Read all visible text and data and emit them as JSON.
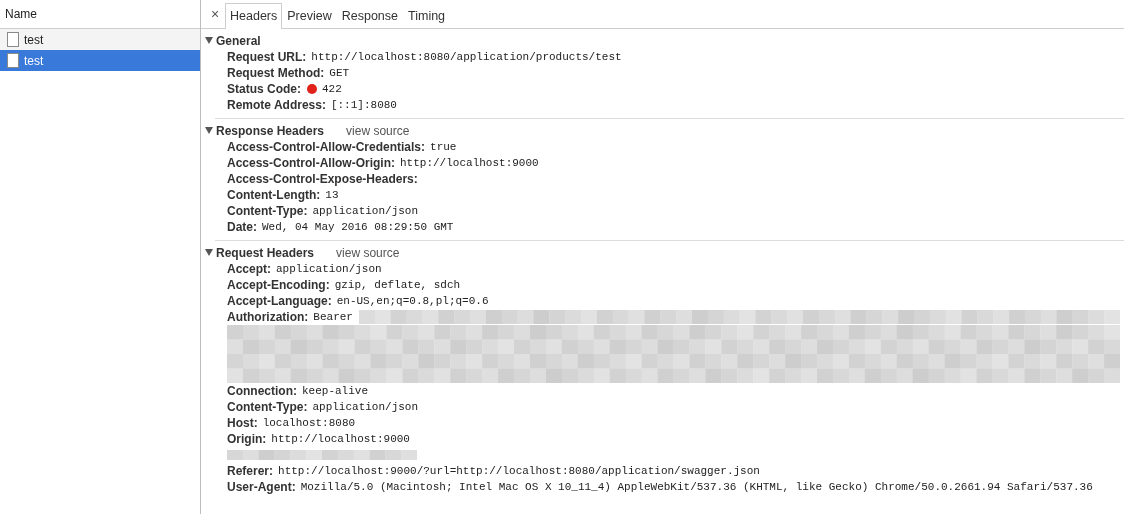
{
  "requests": {
    "column": "Name",
    "items": [
      {
        "name": "test",
        "selected": false
      },
      {
        "name": "test",
        "selected": true
      }
    ]
  },
  "tabs": {
    "close": "×",
    "items": [
      {
        "label": "Headers",
        "selected": true
      },
      {
        "label": "Preview",
        "selected": false
      },
      {
        "label": "Response",
        "selected": false
      },
      {
        "label": "Timing",
        "selected": false
      }
    ]
  },
  "sections": [
    {
      "title": "General",
      "expanded": true,
      "items": [
        {
          "kind": "header",
          "name": "Request URL:",
          "value": "http://localhost:8080/application/products/test"
        },
        {
          "kind": "header",
          "name": "Request Method:",
          "value": "GET"
        },
        {
          "kind": "status",
          "name": "Status Code:",
          "value": "422",
          "color": "#e0221b"
        },
        {
          "kind": "header",
          "name": "Remote Address:",
          "value": "[::1]:8080"
        }
      ]
    },
    {
      "title": "Response Headers",
      "link": "view source",
      "expanded": true,
      "items": [
        {
          "kind": "header",
          "name": "Access-Control-Allow-Credentials:",
          "value": "true"
        },
        {
          "kind": "header",
          "name": "Access-Control-Allow-Origin:",
          "value": "http://localhost:9000"
        },
        {
          "kind": "header",
          "name": "Access-Control-Expose-Headers:"
        },
        {
          "kind": "header",
          "name": "Content-Length:",
          "value": "13"
        },
        {
          "kind": "header",
          "name": "Content-Type:",
          "value": "application/json"
        },
        {
          "kind": "header",
          "name": "Date:",
          "value": "Wed, 04 May 2016 08:29:50 GMT"
        }
      ]
    },
    {
      "title": "Request Headers",
      "link": "view source",
      "expanded": true,
      "items": [
        {
          "kind": "header",
          "name": "Accept:",
          "value": "application/json"
        },
        {
          "kind": "header",
          "name": "Accept-Encoding:",
          "value": "gzip, deflate, sdch"
        },
        {
          "kind": "header",
          "name": "Accept-Language:",
          "value": "en-US,en;q=0.8,pl;q=0.6"
        },
        {
          "kind": "redacted-value",
          "name": "Authorization:",
          "value": "Bearer"
        },
        {
          "kind": "header",
          "name": "Connection:",
          "value": "keep-alive"
        },
        {
          "kind": "header",
          "name": "Content-Type:",
          "value": "application/json"
        },
        {
          "kind": "header",
          "name": "Host:",
          "value": "localhost:8080"
        },
        {
          "kind": "header",
          "name": "Origin:",
          "value": "http://localhost:9000"
        },
        {
          "kind": "redacted"
        },
        {
          "kind": "header",
          "name": "Referer:",
          "value": "http://localhost:9000/?url=http://localhost:8080/application/swagger.json"
        },
        {
          "kind": "header",
          "name": "User-Agent:",
          "value": "Mozilla/5.0 (Macintosh; Intel Mac OS X 10_11_4) AppleWebKit/537.36 (KHTML, like Gecko) Chrome/50.0.2661.94 Safari/537.36"
        }
      ]
    }
  ]
}
